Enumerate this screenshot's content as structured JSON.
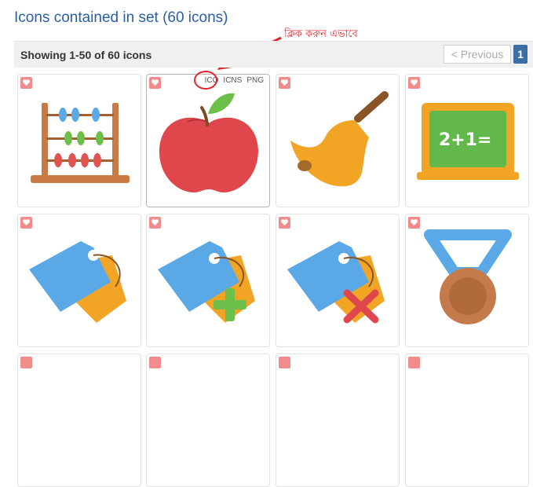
{
  "page": {
    "title": "Icons contained in set (60 icons)",
    "annotation": "ক্লিক করুন এভাবে"
  },
  "toolbar": {
    "showing": "Showing 1-50 of 60 icons",
    "previous_label": "< Previous",
    "page_number": "1"
  },
  "formats": [
    "ICO",
    "ICNS",
    "PNG"
  ],
  "icons": [
    {
      "name": "abacus-icon"
    },
    {
      "name": "apple-icon"
    },
    {
      "name": "bell-icon"
    },
    {
      "name": "chalkboard-icon",
      "text": "2+1="
    },
    {
      "name": "tags-icon"
    },
    {
      "name": "tags-add-icon"
    },
    {
      "name": "tags-remove-icon"
    },
    {
      "name": "medal-icon"
    }
  ],
  "colors": {
    "title": "#2a5ea8",
    "annotation": "#e8222a",
    "page_active": "#3a6ea5",
    "favorite": "#f28c8c"
  }
}
